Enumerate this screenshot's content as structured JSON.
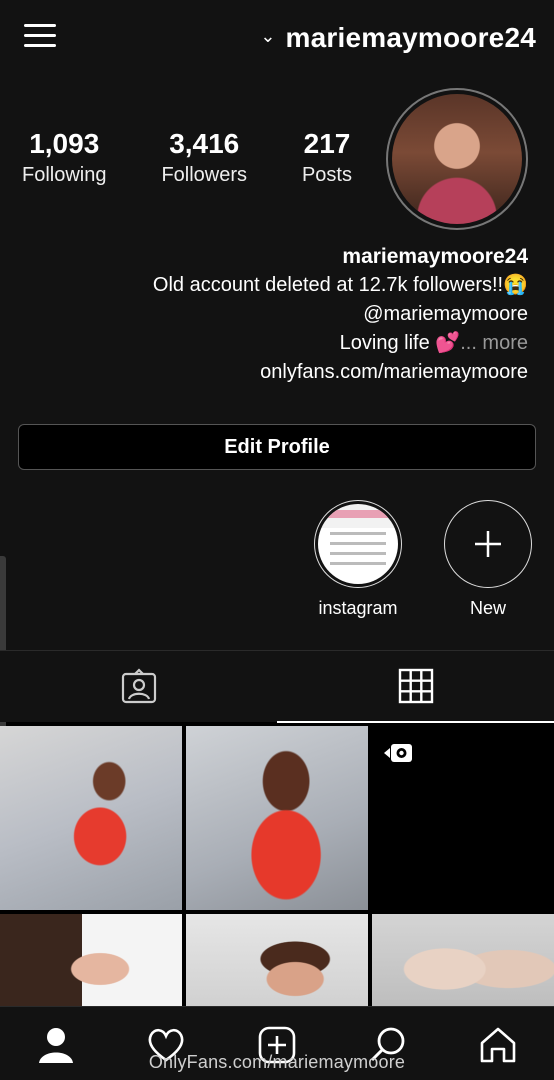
{
  "header": {
    "username": "mariemaymoore24",
    "menu_icon": "hamburger-menu-icon",
    "dropdown_icon": "chevron-down-icon"
  },
  "stats": [
    {
      "value": "217",
      "label": "Posts"
    },
    {
      "value": "3,416",
      "label": "Followers"
    },
    {
      "value": "1,093",
      "label": "Following"
    }
  ],
  "bio": {
    "name": "mariemaymoore24",
    "line1": "Old account deleted at 12.7k followers!!😭",
    "line2": "@mariemaymoore",
    "line3": "Loving life 💕",
    "more": "... more",
    "link": "onlyfans.com/mariemaymoore"
  },
  "edit_button": "Edit Profile",
  "highlights": [
    {
      "label": "New",
      "icon": "plus-icon"
    },
    {
      "label": "instagram",
      "icon": "highlight-thumbnail"
    }
  ],
  "tabs": [
    {
      "name": "grid",
      "icon": "grid-icon",
      "active": true
    },
    {
      "name": "tagged",
      "icon": "tagged-person-icon",
      "active": false
    }
  ],
  "grid_items": [
    {
      "type": "photo"
    },
    {
      "type": "photo"
    },
    {
      "type": "video",
      "icon": "video-camera-icon"
    },
    {
      "type": "photo"
    },
    {
      "type": "photo"
    },
    {
      "type": "photo"
    }
  ],
  "bottom_nav": [
    {
      "name": "home",
      "icon": "home-icon"
    },
    {
      "name": "search",
      "icon": "search-icon"
    },
    {
      "name": "new-post",
      "icon": "add-post-icon"
    },
    {
      "name": "activity",
      "icon": "heart-icon"
    },
    {
      "name": "profile",
      "icon": "profile-icon"
    }
  ],
  "watermark": "OnlyFans.com/mariemaymoore",
  "colors": {
    "background": "#121212",
    "text": "#ffffff",
    "muted": "#999999"
  }
}
